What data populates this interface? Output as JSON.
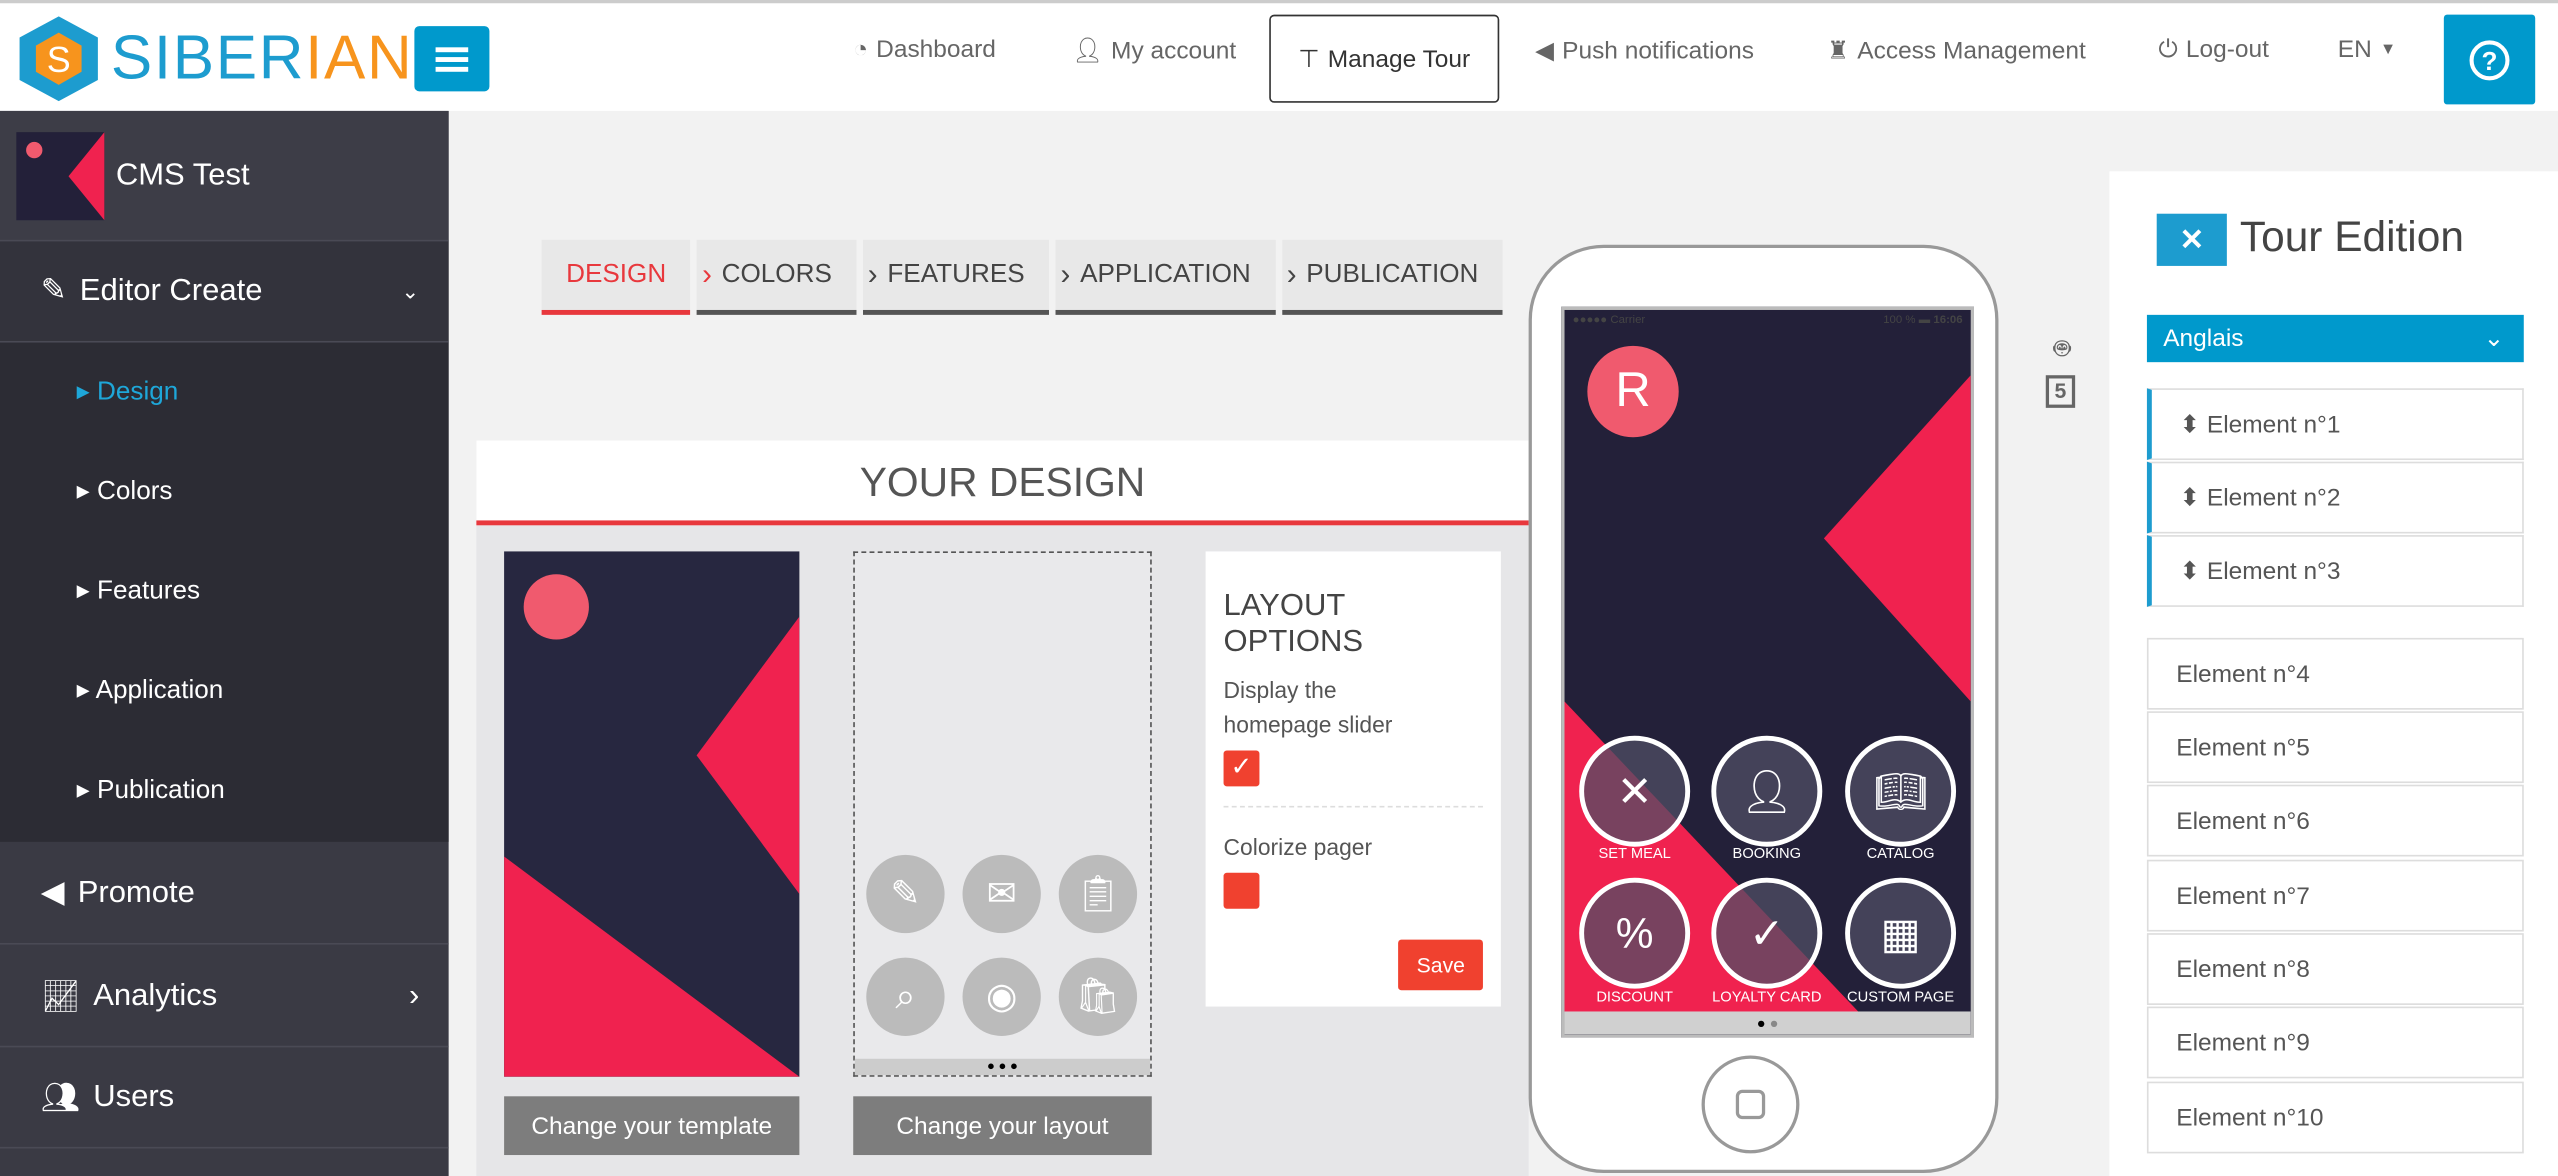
{
  "header": {
    "logo_a": "SIBER",
    "logo_b": "IAN",
    "nav": [
      {
        "label": "Dashboard",
        "icon": "dashboard-icon"
      },
      {
        "label": "My account",
        "icon": "user-icon"
      },
      {
        "label": "Manage Tour",
        "icon": "signpost-icon"
      },
      {
        "label": "Push notifications",
        "icon": "bullhorn-icon"
      },
      {
        "label": "Access Management",
        "icon": "binoculars-icon"
      },
      {
        "label": "Log-out",
        "icon": "power-icon"
      }
    ],
    "lang": "EN",
    "accent": "#0099cc"
  },
  "sidebar": {
    "app_name": "CMS Test",
    "section": "Editor Create",
    "sub": [
      "Design",
      "Colors",
      "Features",
      "Application",
      "Publication"
    ],
    "items": [
      "Promote",
      "Analytics",
      "Users"
    ]
  },
  "steps": [
    "DESIGN",
    "COLORS",
    "FEATURES",
    "APPLICATION",
    "PUBLICATION"
  ],
  "design": {
    "title": "YOUR DESIGN",
    "change_template": "Change your template",
    "change_layout": "Change your layout",
    "options_title": "LAYOUT OPTIONS",
    "opt1": "Display the homepage slider",
    "opt1_checked": true,
    "opt2": "Colorize pager",
    "opt2_checked": false,
    "save": "Save"
  },
  "phone": {
    "carrier": "●●●●● Carrier",
    "battery": "100 %",
    "time": "16:06",
    "features": [
      "SET MEAL",
      "BOOKING",
      "CATALOG",
      "DISCOUNT",
      "LOYALTY CARD",
      "CUSTOM PAGE"
    ]
  },
  "devices": [
    "ios5-icon",
    "ios6-icon",
    "android-icon",
    "html5-icon"
  ],
  "tour": {
    "title": "Tour Edition",
    "language": "Anglais",
    "elements": [
      "Element n°1",
      "Element n°2",
      "Element n°3",
      "Element n°4",
      "Element n°5",
      "Element n°6",
      "Element n°7",
      "Element n°8",
      "Element n°9",
      "Element n°10"
    ]
  }
}
